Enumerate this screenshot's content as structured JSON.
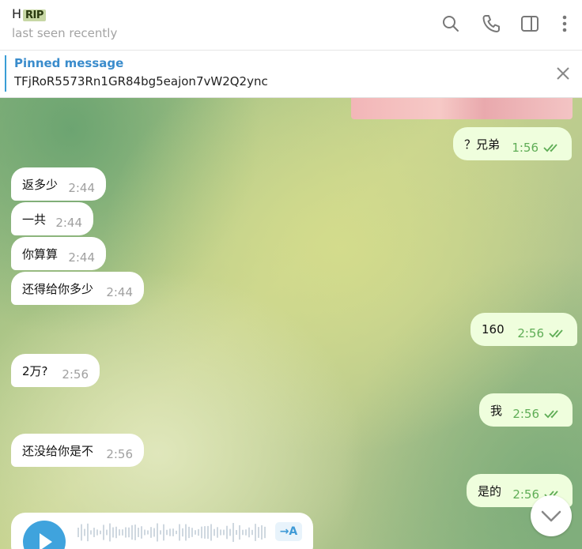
{
  "header": {
    "name": "H",
    "name_badge": "RIP",
    "status": "last seen recently"
  },
  "pinned": {
    "label": "Pinned message",
    "text": "TFjRoR5573Rn1GR84bg5eajon7vW2Q2ync"
  },
  "messages": [
    {
      "dir": "out",
      "text": "？兄弟",
      "time": "1:56"
    },
    {
      "dir": "in",
      "text": "返多少",
      "time": "2:44"
    },
    {
      "dir": "in",
      "text": "一共",
      "time": "2:44"
    },
    {
      "dir": "in",
      "text": "你算算",
      "time": "2:44"
    },
    {
      "dir": "in",
      "text": "还得给你多少",
      "time": "2:44"
    },
    {
      "dir": "out",
      "text": "160",
      "time": "2:56"
    },
    {
      "dir": "in",
      "text": "2万?",
      "time": "2:56"
    },
    {
      "dir": "out",
      "text": "我",
      "time": "2:56"
    },
    {
      "dir": "in",
      "text": "还没给你是不",
      "time": "2:56"
    },
    {
      "dir": "out",
      "text": "是的",
      "time": "2:56"
    }
  ],
  "voice": {
    "transcribe_label": "→A"
  },
  "icons": [
    "search-icon",
    "phone-icon",
    "sidebar-toggle-icon",
    "more-vertical-icon",
    "close-icon",
    "double-check-icon",
    "play-icon",
    "chevron-down-icon"
  ]
}
